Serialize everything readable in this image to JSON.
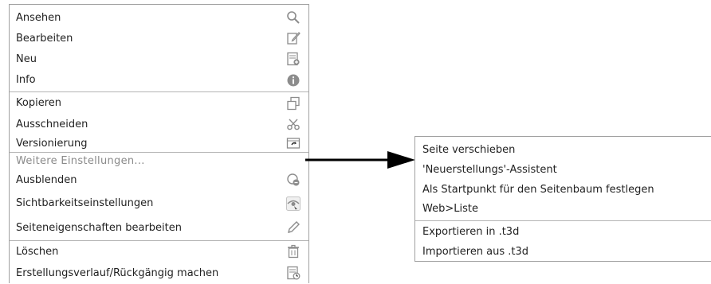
{
  "main_menu": {
    "items": [
      {
        "label": "Ansehen",
        "icon": "magnifier-icon"
      },
      {
        "label": "Bearbeiten",
        "icon": "edit-page-icon"
      },
      {
        "label": "Neu",
        "icon": "new-page-icon"
      },
      {
        "label": "Info",
        "icon": "info-icon"
      },
      {
        "label": "Kopieren",
        "icon": "copy-icon"
      },
      {
        "label": "Ausschneiden",
        "icon": "scissors-icon"
      },
      {
        "label": "Versionierung",
        "icon": "versioning-icon"
      },
      {
        "label": "Weitere Einstellungen..."
      },
      {
        "label": "Ausblenden",
        "icon": "hide-icon"
      },
      {
        "label": "Sichtbarkeitseinstellungen",
        "icon": "visibility-icon"
      },
      {
        "label": "Seiteneigenschaften bearbeiten",
        "icon": "pencil-icon"
      },
      {
        "label": "Löschen",
        "icon": "trash-icon"
      },
      {
        "label": "Erstellungsverlauf/Rückgängig machen",
        "icon": "history-icon"
      }
    ]
  },
  "sub_menu": {
    "items": [
      {
        "label": "Seite verschieben"
      },
      {
        "label": "'Neuerstellungs'-Assistent"
      },
      {
        "label": "Als Startpunkt für den Seitenbaum festlegen"
      },
      {
        "label": "Web>Liste"
      },
      {
        "label": "Exportieren in .t3d"
      },
      {
        "label": "Importieren aus .t3d"
      }
    ]
  },
  "colors": {
    "border": "#a0a0a0",
    "separator": "#b4b4b4",
    "text": "#222222",
    "muted_text": "#8a8a8a",
    "icon": "#8c8c8c",
    "arrow": "#000000"
  }
}
